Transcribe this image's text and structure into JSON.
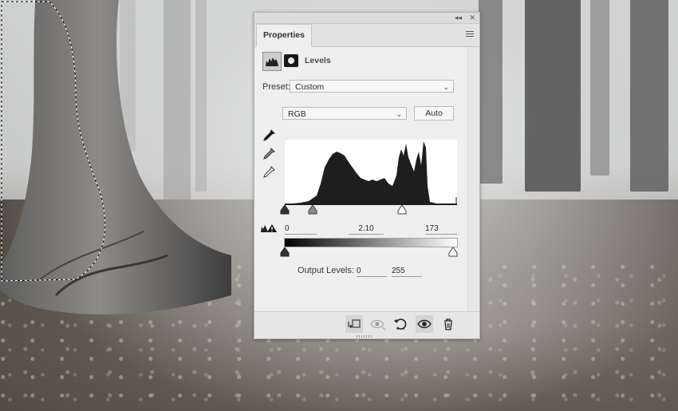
{
  "panel": {
    "title_controls": {
      "collapse": "◂◂",
      "close": "✕"
    },
    "tab_label": "Properties",
    "adjustment_title": "Levels",
    "preset_label": "Preset:",
    "preset_value": "Custom",
    "channel_value": "RGB",
    "auto_label": "Auto",
    "input_levels": {
      "black": "0",
      "gamma": "2.10",
      "white": "173"
    },
    "output_levels_label": "Output Levels:",
    "output_levels": {
      "black": "0",
      "white": "255"
    }
  },
  "icons": [
    "levels-histogram-icon",
    "layer-mask-icon",
    "black-eyedropper-icon",
    "gray-eyedropper-icon",
    "white-eyedropper-icon",
    "clipping-warning-icon",
    "clip-to-layer-icon",
    "view-previous-state-icon",
    "reset-icon",
    "visibility-eye-icon",
    "trash-icon",
    "panel-menu-icon"
  ],
  "colors": {
    "panel_bg": "#efefef",
    "histogram_fill": "#1e1e1e"
  }
}
